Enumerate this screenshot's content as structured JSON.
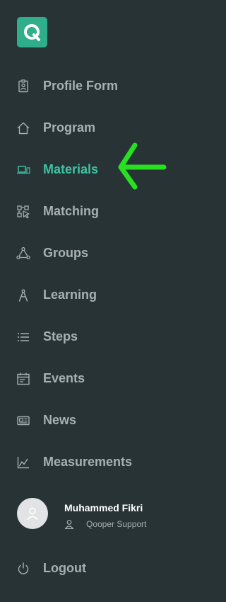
{
  "colors": {
    "background": "#283336",
    "brand": "#2fae8b",
    "active": "#3ec3a2",
    "text": "#a7b0b2",
    "arrow": "#27e020"
  },
  "logo": {
    "letter": "Q"
  },
  "nav": {
    "items": [
      {
        "label": "Profile Form",
        "icon": "id-badge-icon",
        "active": false
      },
      {
        "label": "Program",
        "icon": "home-icon",
        "active": false
      },
      {
        "label": "Materials",
        "icon": "laptop-icon",
        "active": true
      },
      {
        "label": "Matching",
        "icon": "qr-pointer-icon",
        "active": false
      },
      {
        "label": "Groups",
        "icon": "network-icon",
        "active": false
      },
      {
        "label": "Learning",
        "icon": "compass-icon",
        "active": false
      },
      {
        "label": "Steps",
        "icon": "list-icon",
        "active": false
      },
      {
        "label": "Events",
        "icon": "calendar-icon",
        "active": false
      },
      {
        "label": "News",
        "icon": "newspaper-icon",
        "active": false
      },
      {
        "label": "Measurements",
        "icon": "chart-icon",
        "active": false
      }
    ]
  },
  "user": {
    "name": "Muhammed Fikri",
    "role": "Qooper Support"
  },
  "logout": {
    "label": "Logout"
  }
}
